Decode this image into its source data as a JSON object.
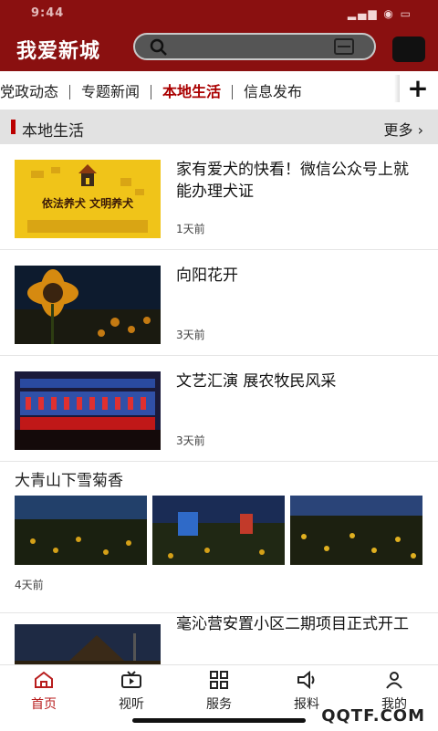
{
  "status": {
    "time": "9:44",
    "indicators": "▂▄▆ ◉ ▭"
  },
  "header": {
    "logo": "我爱新城",
    "search_icon": "search-icon",
    "scan_icon": "scan-icon"
  },
  "tabs": [
    {
      "label": "党政动态",
      "active": false
    },
    {
      "label": "专题新闻",
      "active": false
    },
    {
      "label": "本地生活",
      "active": true
    },
    {
      "label": "信息发布",
      "active": false
    }
  ],
  "tabs_plus": "+",
  "section": {
    "title": "本地生活",
    "more": "更多"
  },
  "articles": [
    {
      "title": "家有爱犬的快看！微信公众号上就能办理犬证",
      "time": "1天前"
    },
    {
      "title": "向阳花开",
      "time": "3天前"
    },
    {
      "title": "文艺汇演  展农牧民风采",
      "time": "3天前"
    }
  ],
  "thumb_text": {
    "banner": "依法养犬  文明养犬"
  },
  "gallery": {
    "title": "大青山下雪菊香",
    "time": "4天前"
  },
  "partial": {
    "title": "毫沁营安置小区二期项目正式开工"
  },
  "nav": [
    {
      "label": "首页",
      "icon": "home-icon",
      "active": true
    },
    {
      "label": "视听",
      "icon": "video-icon",
      "active": false
    },
    {
      "label": "服务",
      "icon": "grid-icon",
      "active": false
    },
    {
      "label": "报料",
      "icon": "megaphone-icon",
      "active": false
    },
    {
      "label": "我的",
      "icon": "person-icon",
      "active": false
    }
  ],
  "watermark": "QQTF.COM",
  "colors": {
    "brand": "#8a1010",
    "accent": "#b81d1d"
  }
}
